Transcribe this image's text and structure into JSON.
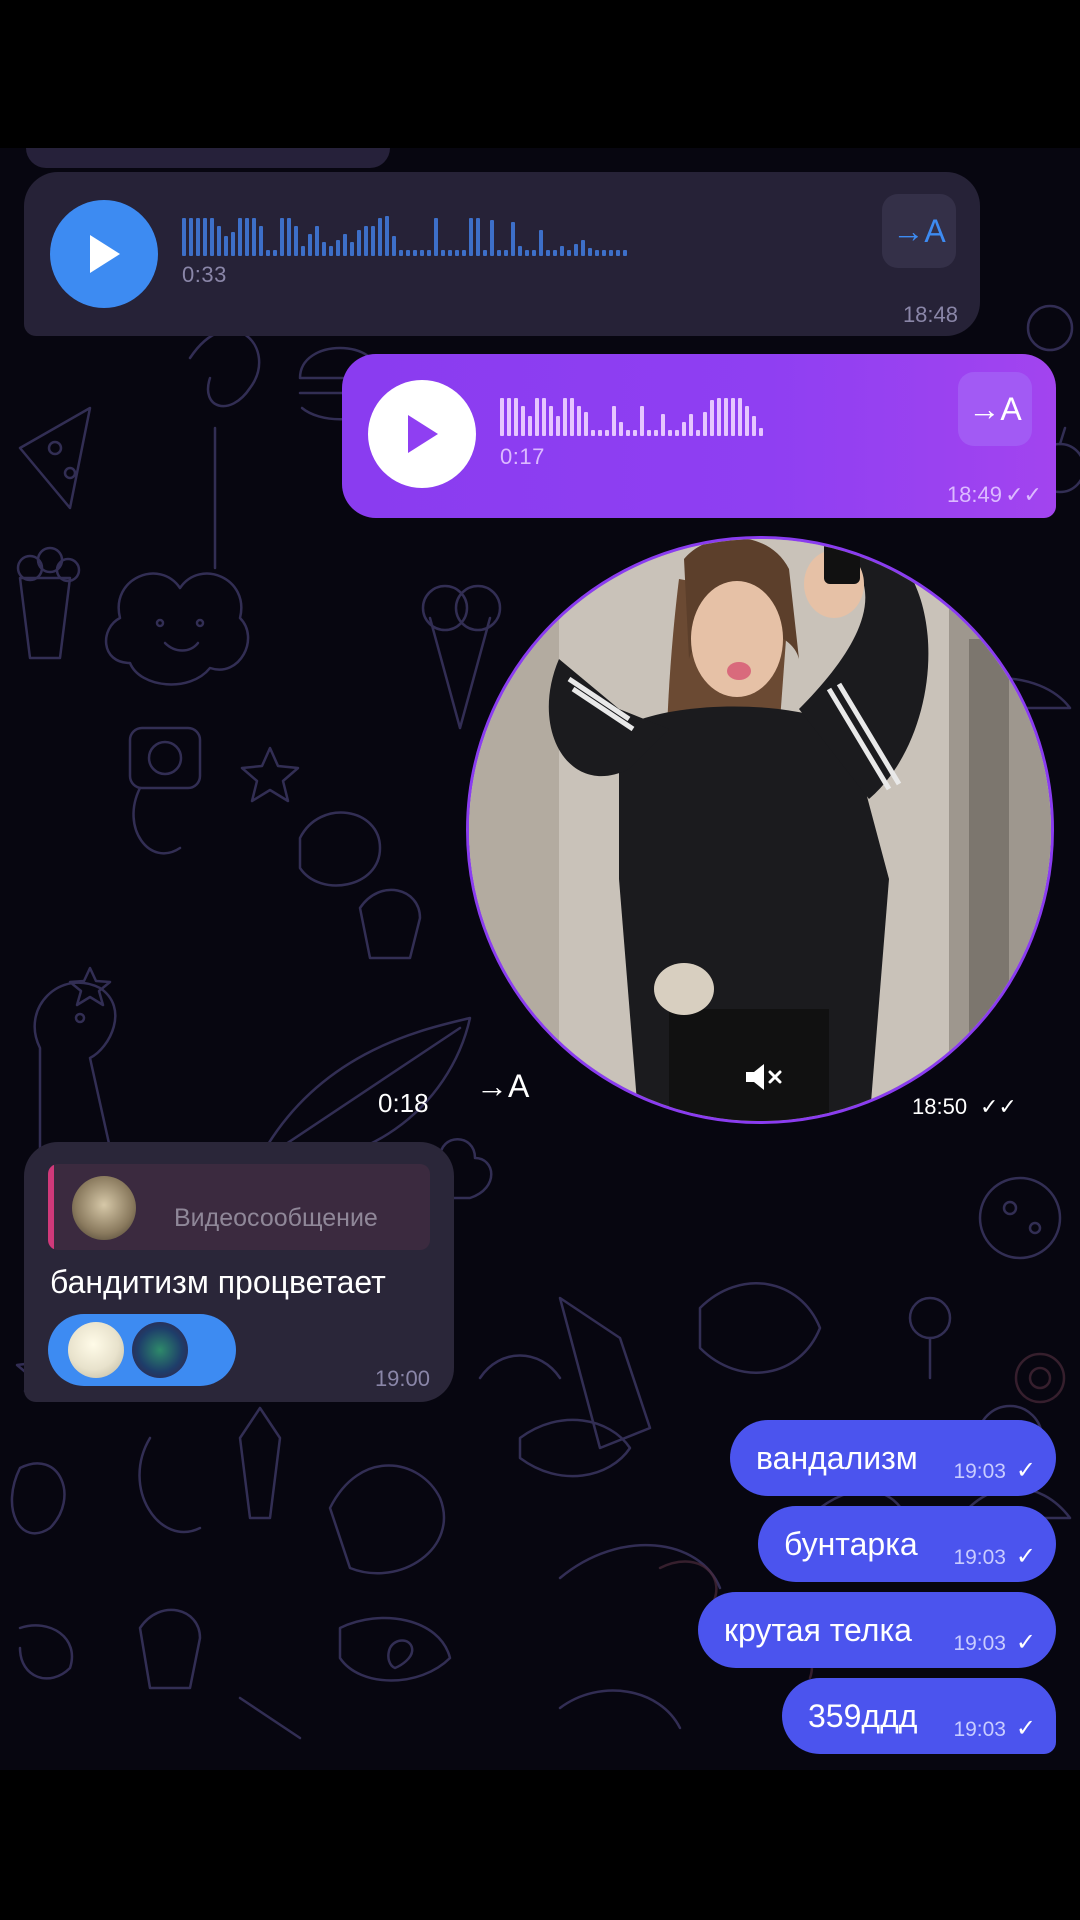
{
  "voice_incoming": {
    "duration": "0:33",
    "time": "18:48",
    "transcribe_label": "→A"
  },
  "voice_outgoing": {
    "duration": "0:17",
    "time": "18:49",
    "checks": "✓✓",
    "transcribe_label": "→A"
  },
  "video_message": {
    "duration": "0:18",
    "transcribe_label": "→A",
    "time": "18:50",
    "checks": "✓✓"
  },
  "reply_message": {
    "quote_label": "Видеосообщение",
    "text": "бандитизм процветает",
    "time": "19:00"
  },
  "outgoing_messages": [
    {
      "text": "вандализм",
      "time": "19:03",
      "check": "✓"
    },
    {
      "text": "бунтарка",
      "time": "19:03",
      "check": "✓"
    },
    {
      "text": "крутая телка",
      "time": "19:03",
      "check": "✓"
    },
    {
      "text": "359ддд",
      "time": "19:03",
      "check": "✓"
    }
  ],
  "colors": {
    "incoming_bubble": "#262237",
    "outgoing_voice": "#8f3ff2",
    "outgoing_text": "#4b54ee",
    "accent_blue": "#3d8bf2",
    "wallpaper": "#070610"
  }
}
